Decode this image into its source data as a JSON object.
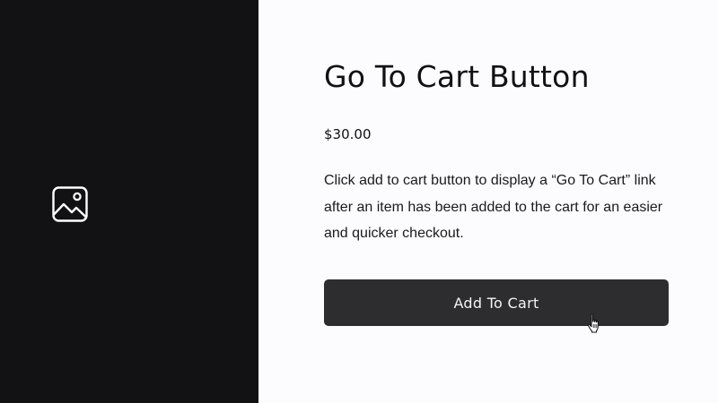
{
  "media": {
    "icon": "image-placeholder-icon"
  },
  "product": {
    "title": "Go To Cart Button",
    "price": "$30.00",
    "description": "Click add to cart button to display a “Go To Cart” link after an item has been added to the cart for an easier and quicker checkout."
  },
  "actions": {
    "add_to_cart_label": "Add To Cart"
  },
  "cursor": {
    "icon": "hand-pointer-icon"
  },
  "colors": {
    "panel_background": "#121113",
    "page_background": "#fcfbfd",
    "button_background": "#2d2c2f",
    "button_text": "#f4f4f6",
    "heading_text": "#111113"
  }
}
